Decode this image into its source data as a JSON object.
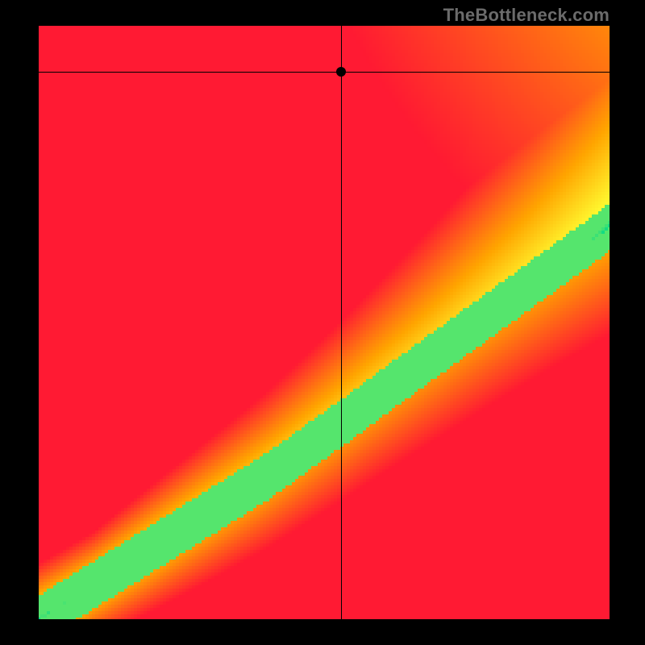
{
  "watermark": "TheBottleneck.com",
  "chart_data": {
    "type": "heatmap",
    "title": "",
    "xlabel": "",
    "ylabel": "",
    "x_range": [
      0,
      100
    ],
    "y_range": [
      0,
      100
    ],
    "crosshair": {
      "x": 53,
      "y": 92
    },
    "optimal_band": {
      "description": "Green low-bottleneck diagonal band",
      "points": [
        {
          "x": 0,
          "y": 0
        },
        {
          "x": 20,
          "y": 12
        },
        {
          "x": 40,
          "y": 24
        },
        {
          "x": 53,
          "y": 33
        },
        {
          "x": 60,
          "y": 38
        },
        {
          "x": 80,
          "y": 52
        },
        {
          "x": 100,
          "y": 66
        }
      ],
      "band_halfwidth_y": 4
    },
    "gradient_stops": {
      "best": "#00d88a",
      "good": "#ffff33",
      "mid": "#ffa500",
      "worst": "#ff1a33"
    },
    "grid": false,
    "ticks": {
      "x": [],
      "y": []
    }
  }
}
